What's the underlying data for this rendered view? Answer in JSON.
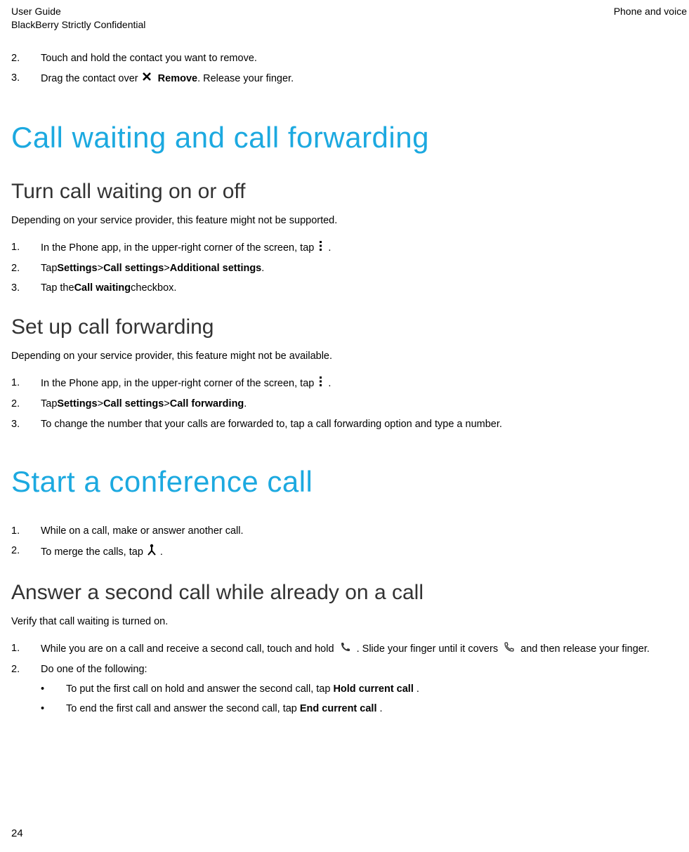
{
  "header": {
    "left_line1": "User Guide",
    "left_line2": "BlackBerry Strictly Confidential",
    "right": "Phone and voice"
  },
  "list1": {
    "item2_marker": "2.",
    "item2_text": "Touch and hold the contact you want to remove.",
    "item3_marker": "3.",
    "item3_pre": "Drag the contact over ",
    "item3_bold": "Remove",
    "item3_post": ". Release your finger."
  },
  "h1_1": "Call waiting and call forwarding",
  "h2_1": "Turn call waiting on or off",
  "p1": "Depending on your service provider, this feature might not be supported.",
  "list2": {
    "m1": "1.",
    "t1_pre": "In the Phone app, in the upper-right corner of the screen, tap ",
    "t1_post": " .",
    "m2": "2.",
    "t2_pre": "Tap ",
    "t2_b1": "Settings",
    "t2_gt1": " > ",
    "t2_b2": "Call settings",
    "t2_gt2": " > ",
    "t2_b3": "Additional settings",
    "t2_post": ".",
    "m3": "3.",
    "t3_pre": "Tap the ",
    "t3_b1": "Call waiting",
    "t3_post": " checkbox."
  },
  "h2_2": "Set up call forwarding",
  "p2": "Depending on your service provider, this feature might not be available.",
  "list3": {
    "m1": "1.",
    "t1_pre": "In the Phone app, in the upper-right corner of the screen, tap ",
    "t1_post": " .",
    "m2": "2.",
    "t2_pre": "Tap ",
    "t2_b1": "Settings",
    "t2_gt1": " > ",
    "t2_b2": "Call settings",
    "t2_gt2": " > ",
    "t2_b3": "Call forwarding",
    "t2_post": ".",
    "m3": "3.",
    "t3": "To change the number that your calls are forwarded to, tap a call forwarding option and type a number."
  },
  "h1_2": "Start a conference call",
  "list4": {
    "m1": "1.",
    "t1": "While on a call, make or answer another call.",
    "m2": "2.",
    "t2_pre": "To merge the calls, tap ",
    "t2_post": " ."
  },
  "h2_3": "Answer a second call while already on a call",
  "p3": "Verify that call waiting is turned on.",
  "list5": {
    "m1": "1.",
    "t1_pre": "While you are on a call and receive a second call, touch and hold ",
    "t1_mid": " . Slide your finger until it covers ",
    "t1_post": " and then release your finger.",
    "m2": "2.",
    "t2": "Do one of the following:"
  },
  "bullets": {
    "bm": "•",
    "b1_pre": "To put the first call on hold and answer the second call, tap ",
    "b1_b": "Hold current call",
    "b1_post": ".",
    "b2_pre": "To end the first call and answer the second call, tap ",
    "b2_b": "End current call",
    "b2_post": "."
  },
  "page_num": "24",
  "icons": {
    "remove": "close-icon",
    "more": "more-vert-icon",
    "merge": "merge-calls-icon",
    "phone": "phone-icon",
    "answer": "phone-outline-icon"
  }
}
